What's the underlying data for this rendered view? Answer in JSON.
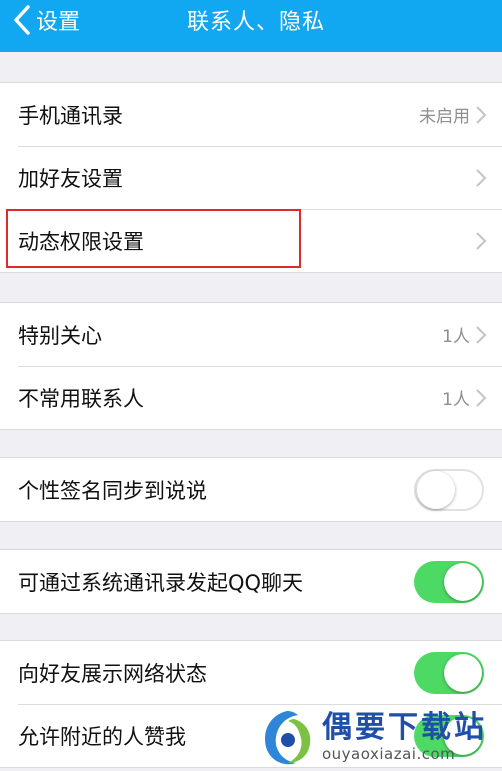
{
  "navbar": {
    "back_label": "设置",
    "title": "联系人、隐私",
    "background": "#12a7f1"
  },
  "group1": {
    "items": [
      {
        "label": "手机通讯录",
        "value": "未启用",
        "icon": "chevron-right-icon"
      },
      {
        "label": "加好友设置",
        "value": "",
        "icon": "chevron-right-icon"
      },
      {
        "label": "动态权限设置",
        "value": "",
        "icon": "chevron-right-icon",
        "highlighted": true
      }
    ]
  },
  "group2": {
    "items": [
      {
        "label": "特别关心",
        "value": "1人",
        "icon": "chevron-right-icon"
      },
      {
        "label": "不常用联系人",
        "value": "1人",
        "icon": "chevron-right-icon"
      }
    ]
  },
  "group3": {
    "items": [
      {
        "label": "个性签名同步到说说",
        "toggle": "off"
      }
    ]
  },
  "group4": {
    "items": [
      {
        "label": "可通过系统通讯录发起QQ聊天",
        "toggle": "on"
      }
    ]
  },
  "group5": {
    "items": [
      {
        "label": "向好友展示网络状态",
        "toggle": "on"
      },
      {
        "label": "允许附近的人赞我",
        "toggle": "on"
      }
    ]
  },
  "colors": {
    "toggle_on": "#4cd964",
    "highlight_box": "#e02a2a",
    "watermark_text": "#1f4fa8"
  },
  "watermark": {
    "title": "偶要下载站",
    "url": "ouyaoxiazai.com"
  }
}
